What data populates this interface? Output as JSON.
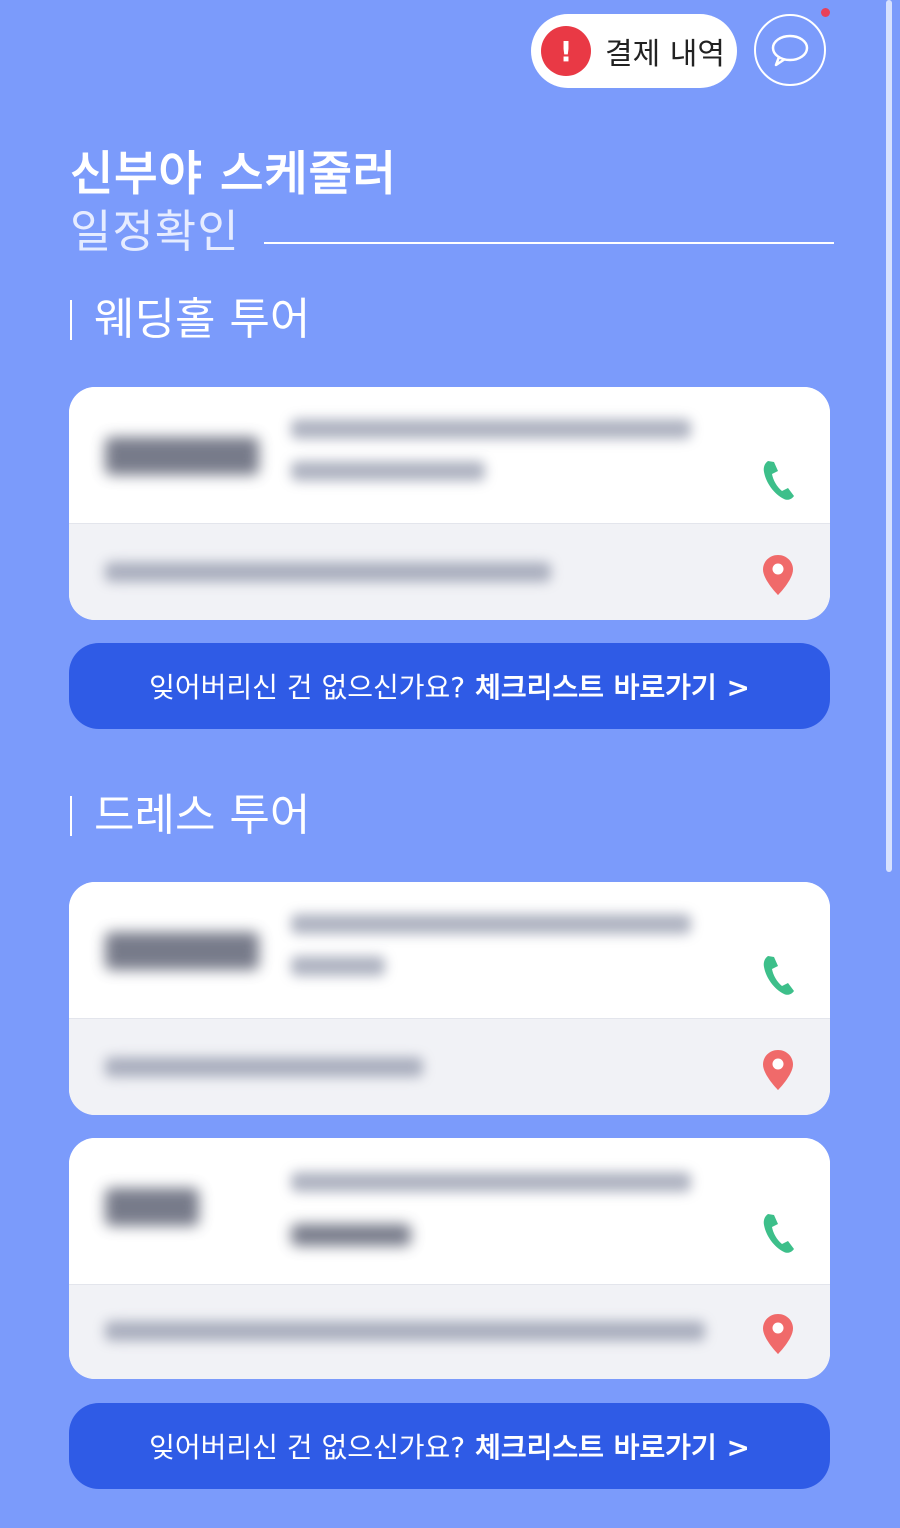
{
  "header": {
    "payment_label": "결제 내역",
    "alert_glyph": "!",
    "chat_icon": "chat-bubble-icon"
  },
  "page": {
    "title": "신부야 스케줄러",
    "subtitle": "일정확인"
  },
  "sections": [
    {
      "title": "웨딩홀 투어",
      "cards": [
        {
          "phone_icon": "phone-icon",
          "location_icon": "location-pin-icon"
        }
      ]
    },
    {
      "title": "드레스 투어",
      "cards": [
        {
          "phone_icon": "phone-icon",
          "location_icon": "location-pin-icon"
        },
        {
          "phone_icon": "phone-icon",
          "location_icon": "location-pin-icon"
        }
      ]
    }
  ],
  "checklist": {
    "prompt": "잊어버리신 건 없으신가요?",
    "link": "체크리스트 바로가기 >"
  },
  "colors": {
    "background": "#7b9bfb",
    "button": "#2f5be6",
    "alert": "#e93945",
    "phone": "#3dbf8a",
    "pin": "#f06a6a"
  }
}
